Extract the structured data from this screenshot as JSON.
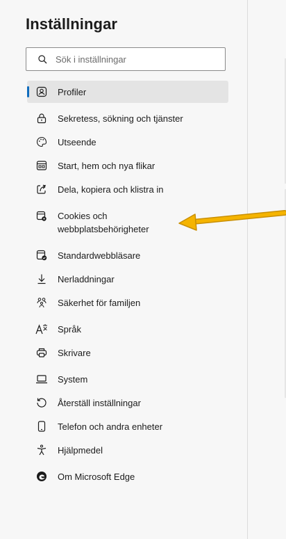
{
  "sidebar": {
    "title": "Inställningar",
    "search": {
      "placeholder": "Sök i inställningar"
    },
    "items": [
      {
        "label": "Profiler",
        "icon": "profile-icon"
      },
      {
        "label": "Sekretess, sökning och tjänster",
        "icon": "lock-icon"
      },
      {
        "label": "Utseende",
        "icon": "palette-icon"
      },
      {
        "label": "Start, hem och nya flikar",
        "icon": "home-tabs-icon"
      },
      {
        "label": "Dela, kopiera och klistra in",
        "icon": "share-icon"
      },
      {
        "label": "Cookies och",
        "label2": "webbplatsbehörigheter",
        "icon": "cookies-permissions-icon"
      },
      {
        "label": "Standardwebbläsare",
        "icon": "default-browser-icon"
      },
      {
        "label": "Nerladdningar",
        "icon": "download-icon"
      },
      {
        "label": "Säkerhet för familjen",
        "icon": "family-icon"
      },
      {
        "label": "Språk",
        "icon": "language-icon"
      },
      {
        "label": "Skrivare",
        "icon": "printer-icon"
      },
      {
        "label": "System",
        "icon": "laptop-icon"
      },
      {
        "label": "Återställ inställningar",
        "icon": "reset-icon"
      },
      {
        "label": "Telefon och andra enheter",
        "icon": "phone-icon"
      },
      {
        "label": "Hjälpmedel",
        "icon": "accessibility-icon"
      },
      {
        "label": "Om Microsoft Edge",
        "icon": "edge-logo-icon"
      }
    ],
    "active_index": 0
  },
  "colors": {
    "accent": "#0f6cbd",
    "arrow": "#f5b400",
    "sidebar_bg": "#f7f7f7",
    "active_bg": "#e4e4e4"
  }
}
